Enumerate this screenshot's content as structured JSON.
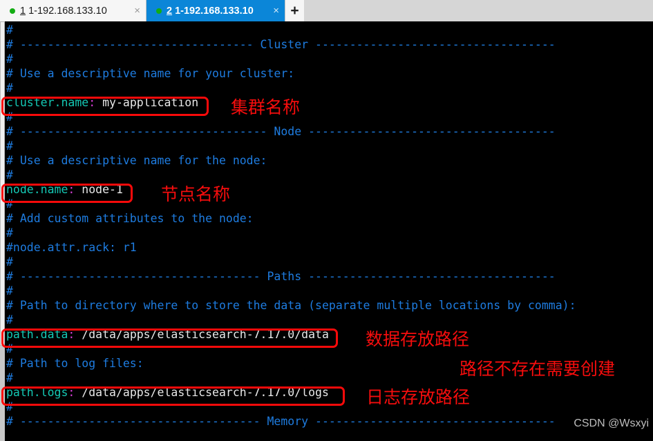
{
  "window": {
    "title": "1-192.168.133.10"
  },
  "tabbar": {
    "tabs": [
      {
        "number": "1",
        "title": "1-192.168.133.10",
        "close_label": "×",
        "status_icon": "green-dot-icon",
        "active": false
      },
      {
        "number": "2",
        "title": "1-192.168.133.10",
        "close_label": "×",
        "status_icon": "green-dot-icon",
        "active": true
      }
    ],
    "add_tab_label": "+"
  },
  "terminal": {
    "lines": [
      {
        "id": "l01",
        "text": "#"
      },
      {
        "id": "l02",
        "text": "# ---------------------------------- Cluster -----------------------------------"
      },
      {
        "id": "l03",
        "text": "#"
      },
      {
        "id": "l04",
        "text": "# Use a descriptive name for your cluster:"
      },
      {
        "id": "l05",
        "text": "#"
      },
      {
        "id": "l06",
        "key": "cluster.name",
        "colon": ":",
        "value": " my-application"
      },
      {
        "id": "l07",
        "text": "#"
      },
      {
        "id": "l08",
        "text": "# ------------------------------------ Node ------------------------------------"
      },
      {
        "id": "l09",
        "text": "#"
      },
      {
        "id": "l10",
        "text": "# Use a descriptive name for the node:"
      },
      {
        "id": "l11",
        "text": "#"
      },
      {
        "id": "l12",
        "key": "node.name",
        "colon": ":",
        "value": " node-1"
      },
      {
        "id": "l13",
        "text": "#"
      },
      {
        "id": "l14",
        "text": "# Add custom attributes to the node:"
      },
      {
        "id": "l15",
        "text": "#"
      },
      {
        "id": "l16",
        "text": "#node.attr.rack: r1"
      },
      {
        "id": "l17",
        "text": "#"
      },
      {
        "id": "l18",
        "text": "# ----------------------------------- Paths ------------------------------------"
      },
      {
        "id": "l19",
        "text": "#"
      },
      {
        "id": "l20",
        "text": "# Path to directory where to store the data (separate multiple locations by comma):"
      },
      {
        "id": "l21",
        "text": "#"
      },
      {
        "id": "l22",
        "key": "path.data",
        "colon": ":",
        "value": " /data/apps/elasticsearch-7.17.0/data"
      },
      {
        "id": "l23",
        "text": "#"
      },
      {
        "id": "l24",
        "text": "# Path to log files:"
      },
      {
        "id": "l25",
        "text": "#"
      },
      {
        "id": "l26",
        "key": "path.logs",
        "colon": ":",
        "value": " /data/apps/elasticsearch-7.17.0/logs"
      },
      {
        "id": "l27",
        "text": "#"
      },
      {
        "id": "l28",
        "text": "# ----------------------------------- Memory -----------------------------------"
      }
    ],
    "watermark": "CSDN @Wsxyi"
  },
  "annotations": [
    {
      "id": "a1",
      "text": "集群名称",
      "meaning": "cluster-name"
    },
    {
      "id": "a2",
      "text": "节点名称",
      "meaning": "node-name"
    },
    {
      "id": "a3",
      "text": "数据存放路径",
      "meaning": "data-storage-path"
    },
    {
      "id": "a4",
      "text": "路径不存在需要创建",
      "meaning": "path-must-be-created"
    },
    {
      "id": "a5",
      "text": "日志存放路径",
      "meaning": "log-storage-path"
    }
  ],
  "colors": {
    "terminal_bg": "#000000",
    "comment": "#1e7ce0",
    "key": "#14c8b4",
    "colon": "#d83fd8",
    "value": "#e8e8e8",
    "annotation_red": "#f60d0d",
    "active_tab_blue": "#0b86d8",
    "status_green": "#13ad13",
    "watermark_gray": "#bdbdbd"
  }
}
